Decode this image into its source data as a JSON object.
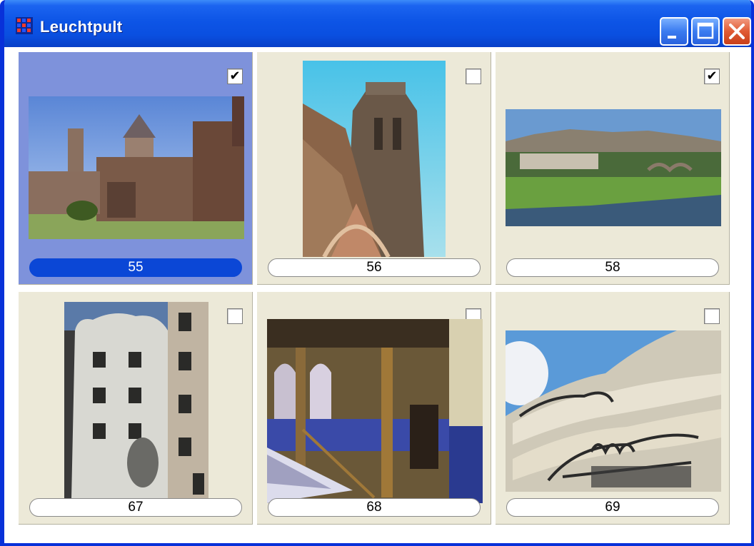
{
  "window": {
    "title": "Leuchtpult"
  },
  "colors": {
    "titlebar": "#0a4fe0",
    "selection": "#7e92db",
    "selected_label": "#0b47d6",
    "cell_bg": "#ece9d8"
  },
  "titlebar_buttons": [
    {
      "name": "minimize-button",
      "icon": "minimize-icon"
    },
    {
      "name": "maximize-button",
      "icon": "maximize-icon"
    },
    {
      "name": "close-button",
      "icon": "close-icon"
    }
  ],
  "thumbnails": [
    {
      "label": "55",
      "checked": true,
      "selected": true,
      "subject": "castle walls with towers"
    },
    {
      "label": "56",
      "checked": false,
      "selected": false,
      "subject": "gothic church tower"
    },
    {
      "label": "58",
      "checked": true,
      "selected": false,
      "subject": "fortified city above river meadow"
    },
    {
      "label": "67",
      "checked": false,
      "selected": false,
      "subject": "modernist building facade"
    },
    {
      "label": "68",
      "checked": false,
      "selected": false,
      "subject": "arched interior staircase"
    },
    {
      "label": "69",
      "checked": false,
      "selected": false,
      "subject": "wavy stone facade with iron balconies"
    }
  ]
}
